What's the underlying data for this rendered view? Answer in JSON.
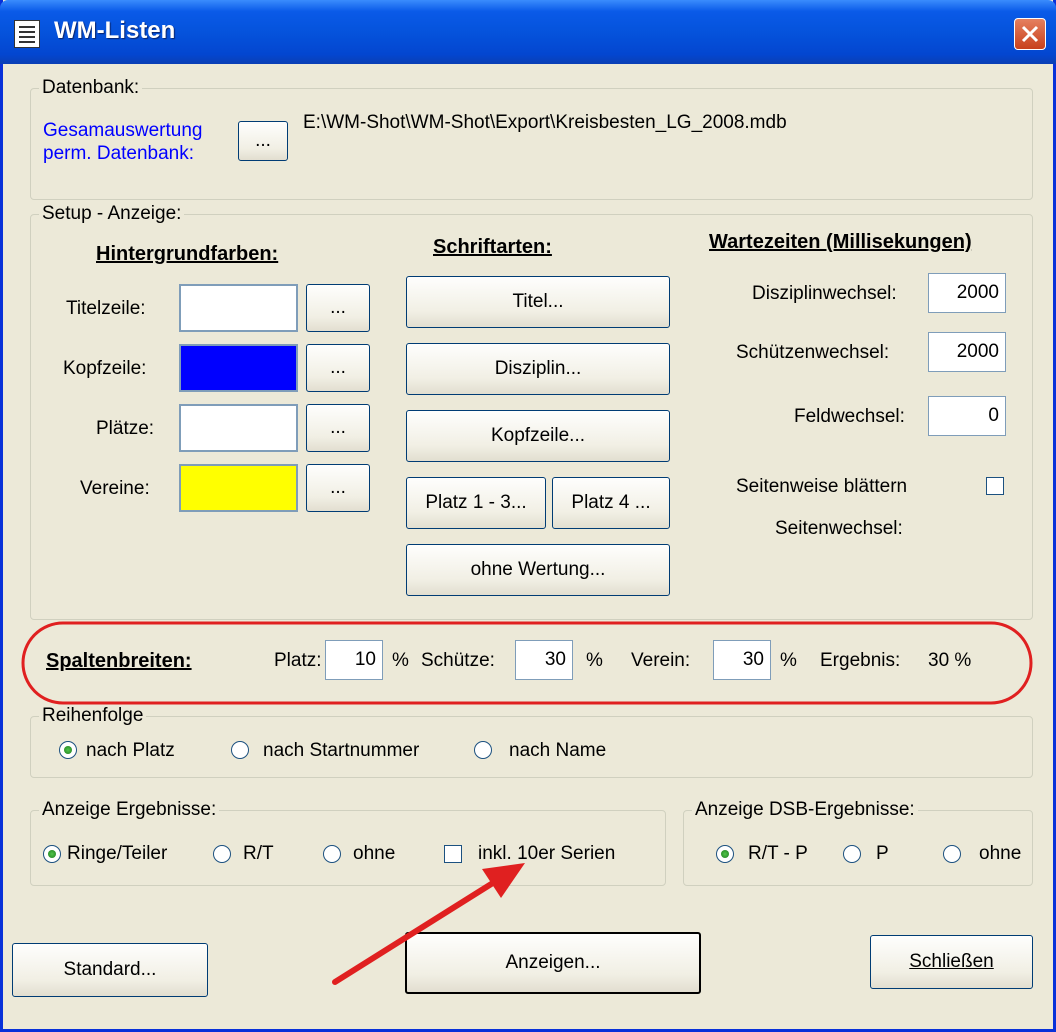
{
  "window": {
    "title": "WM-Listen"
  },
  "datenbank": {
    "legend": "Datenbank:",
    "label_line1": "Gesamauswertung",
    "label_line2": "perm. Datenbank:",
    "browse_label": "...",
    "path": "E:\\WM-Shot\\WM-Shot\\Export\\Kreisbesten_LG_2008.mdb"
  },
  "setup": {
    "legend": "Setup - Anzeige:",
    "colors_header": "Hintergrundfarben:",
    "colors": [
      {
        "label": "Titelzeile:",
        "color": "#ffffff",
        "button": "..."
      },
      {
        "label": "Kopfzeile:",
        "color": "#0000ff",
        "button": "..."
      },
      {
        "label": "Plätze:",
        "color": "#ffffff",
        "button": "..."
      },
      {
        "label": "Vereine:",
        "color": "#ffff00",
        "button": "..."
      }
    ],
    "fonts_header": "Schriftarten:",
    "fonts": {
      "titel": "Titel...",
      "disziplin": "Disziplin...",
      "kopfzeile": "Kopfzeile...",
      "platz13": "Platz 1 - 3...",
      "platz4": "Platz 4 ...",
      "ohne_wertung": "ohne Wertung..."
    },
    "waits_header": "Wartezeiten (Millisekungen)",
    "waits": [
      {
        "label": "Disziplinwechsel:",
        "value": "2000"
      },
      {
        "label": "Schützenwechsel:",
        "value": "2000"
      },
      {
        "label": "Feldwechsel:",
        "value": "0"
      }
    ],
    "page_flip_label": "Seitenweise blättern",
    "page_flip_checked": false,
    "page_change_label": "Seitenwechsel:"
  },
  "columns": {
    "header": "Spaltenbreiten:",
    "platz_label": "Platz:",
    "platz_value": "10",
    "pct1": "%",
    "schuetze_label": "Schütze:",
    "schuetze_value": "30",
    "pct2": "%",
    "verein_label": "Verein:",
    "verein_value": "30",
    "pct3": "%",
    "ergebnis_label": "Ergebnis:",
    "ergebnis_value": "30 %"
  },
  "order": {
    "legend": "Reihenfolge",
    "options": [
      "nach Platz",
      "nach Startnummer",
      "nach Name"
    ],
    "selected": "nach Platz"
  },
  "results": {
    "legend": "Anzeige Ergebnisse:",
    "options": [
      "Ringe/Teiler",
      "R/T",
      "ohne"
    ],
    "selected": "Ringe/Teiler",
    "series_label": "inkl. 10er Serien",
    "series_checked": false
  },
  "dsb": {
    "legend": "Anzeige DSB-Ergebnisse:",
    "options": [
      "R/T - P",
      "P",
      "ohne"
    ],
    "selected": "R/T - P"
  },
  "buttons": {
    "standard": "Standard...",
    "anzeigen": "Anzeigen...",
    "schliessen": "Schließen"
  },
  "annotation_color": "#e02020"
}
